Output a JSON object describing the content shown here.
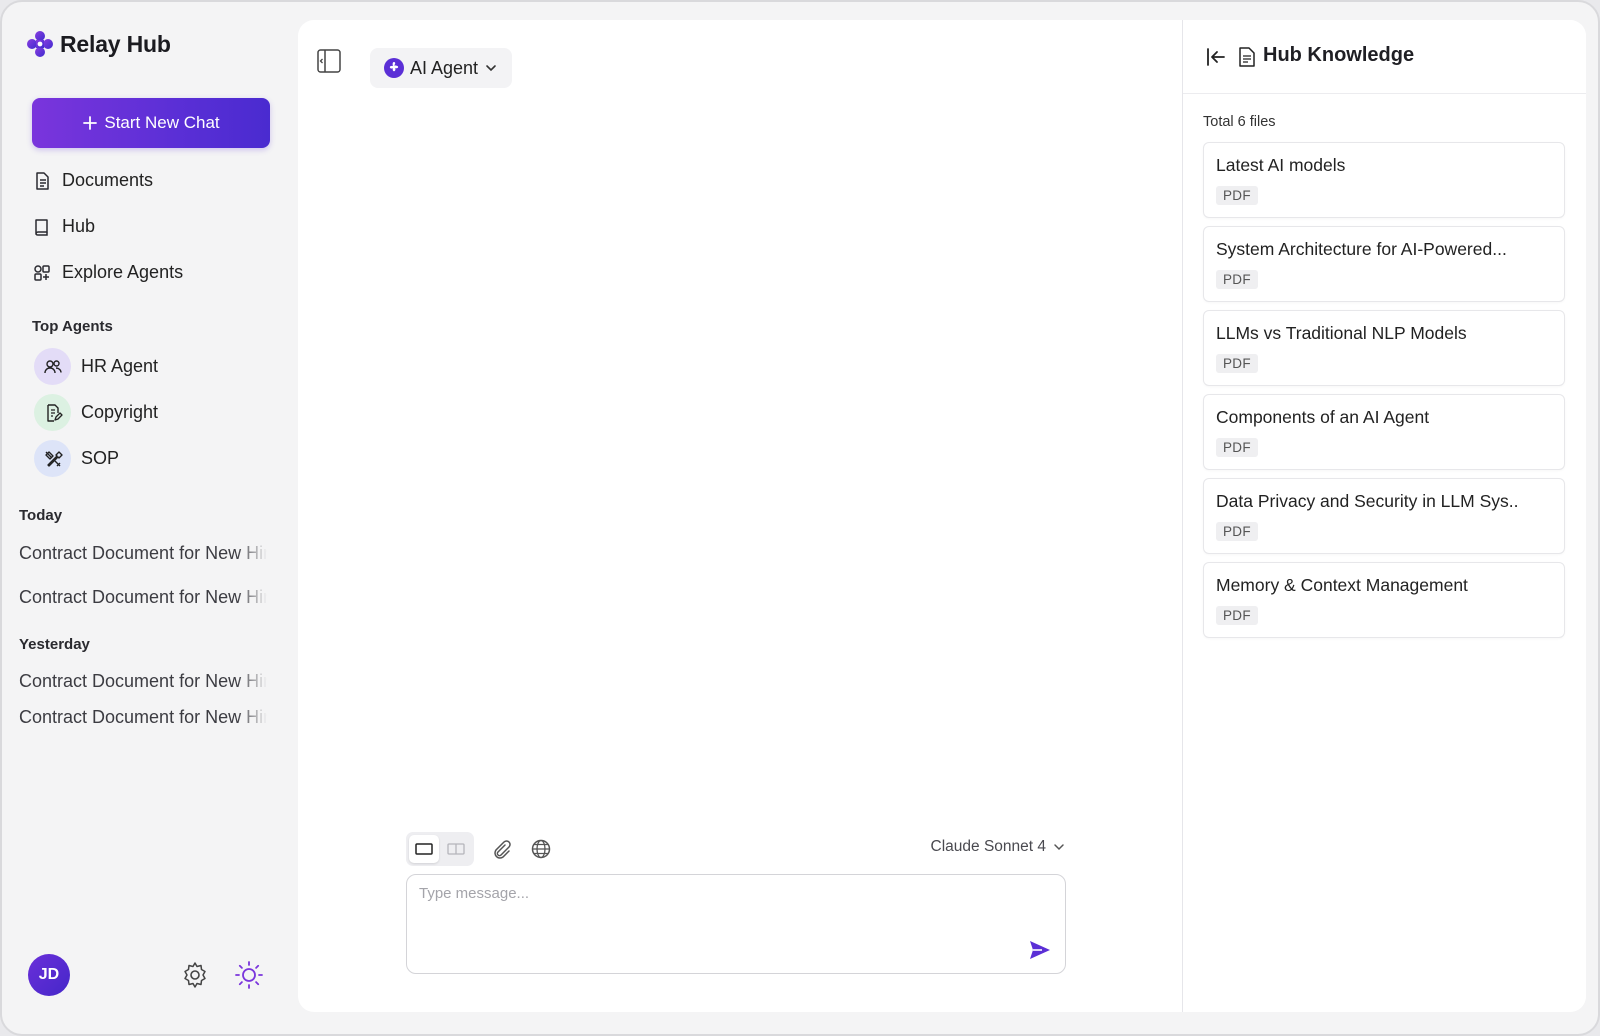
{
  "app": {
    "name": "Relay Hub"
  },
  "sidebar": {
    "new_chat_label": "Start New Chat",
    "nav": [
      {
        "label": "Documents",
        "icon": "document-icon"
      },
      {
        "label": "Hub",
        "icon": "book-icon"
      },
      {
        "label": "Explore Agents",
        "icon": "grid-icon"
      }
    ],
    "top_agents_label": "Top Agents",
    "agents": [
      {
        "label": "HR Agent",
        "icon": "users-icon"
      },
      {
        "label": "Copyright",
        "icon": "document-edit-icon"
      },
      {
        "label": "SOP",
        "icon": "tools-icon"
      }
    ],
    "history": {
      "today_label": "Today",
      "today": [
        "Contract Document for New Hire",
        "Contract Document for New Hire"
      ],
      "yesterday_label": "Yesterday",
      "yesterday": [
        "Contract Document for New Hire",
        "Contract Document for New Hire"
      ]
    },
    "user_initials": "JD"
  },
  "main": {
    "agent_selector": "AI Agent",
    "composer": {
      "model": "Claude Sonnet 4",
      "placeholder": "Type message..."
    }
  },
  "knowledge": {
    "title": "Hub Knowledge",
    "total": "Total 6 files",
    "files": [
      {
        "name": "Latest AI models",
        "type": "PDF"
      },
      {
        "name": "System Architecture for AI-Powered...",
        "type": "PDF"
      },
      {
        "name": "LLMs vs Traditional NLP Models",
        "type": "PDF"
      },
      {
        "name": "Components of an AI Agent",
        "type": "PDF"
      },
      {
        "name": "Data Privacy and Security in LLM Sys..",
        "type": "PDF"
      },
      {
        "name": "Memory & Context Management",
        "type": "PDF"
      }
    ]
  },
  "colors": {
    "accent": "#5b2fd6",
    "accent_light": "#7a35dc",
    "background": "#f4f4f5"
  }
}
